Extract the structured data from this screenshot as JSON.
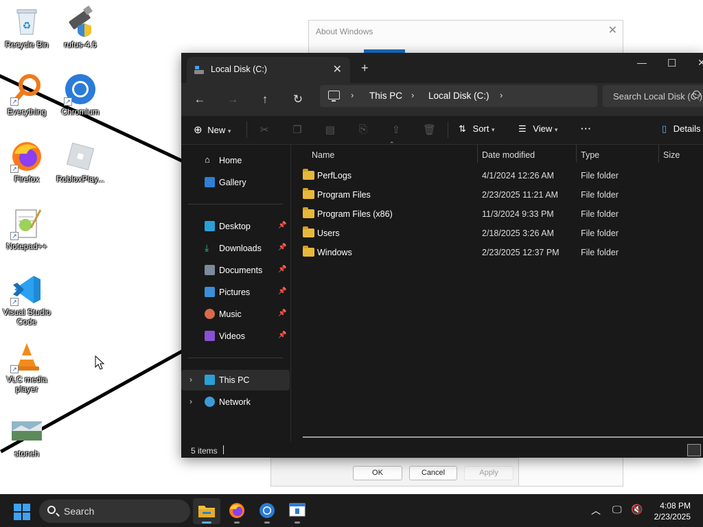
{
  "desktop": {
    "icons": [
      {
        "label": "Recycle Bin"
      },
      {
        "label": "rufus-4.6"
      },
      {
        "label": "Everything"
      },
      {
        "label": "Chromium"
      },
      {
        "label": "Firefox"
      },
      {
        "label": "RobloxPlay..."
      },
      {
        "label": "Notepad++"
      },
      {
        "label": "Visual Studio Code"
      },
      {
        "label": "VLC media player"
      },
      {
        "label": "stoneh"
      }
    ]
  },
  "about_dialog": {
    "title": "About Windows",
    "ok_label": "OK",
    "cancel_label": "Cancel",
    "apply_label": "Apply"
  },
  "explorer": {
    "tab_title": "Local Disk (C:)",
    "breadcrumb": [
      "This PC",
      "Local Disk (C:)"
    ],
    "search_placeholder": "Search Local Disk (C:)",
    "toolbar": {
      "new_label": "New",
      "sort_label": "Sort",
      "view_label": "View",
      "details_label": "Details"
    },
    "sidebar": {
      "home": "Home",
      "gallery": "Gallery",
      "quick": [
        {
          "label": "Desktop"
        },
        {
          "label": "Downloads"
        },
        {
          "label": "Documents"
        },
        {
          "label": "Pictures"
        },
        {
          "label": "Music"
        },
        {
          "label": "Videos"
        }
      ],
      "this_pc": "This PC",
      "network": "Network"
    },
    "columns": [
      "Name",
      "Date modified",
      "Type",
      "Size"
    ],
    "files": [
      {
        "name": "PerfLogs",
        "date": "4/1/2024 12:26 AM",
        "type": "File folder"
      },
      {
        "name": "Program Files",
        "date": "2/23/2025 11:21 AM",
        "type": "File folder"
      },
      {
        "name": "Program Files (x86)",
        "date": "11/3/2024 9:33 PM",
        "type": "File folder"
      },
      {
        "name": "Users",
        "date": "2/18/2025 3:26 AM",
        "type": "File folder"
      },
      {
        "name": "Windows",
        "date": "2/23/2025 12:37 PM",
        "type": "File folder"
      }
    ],
    "status": "5 items"
  },
  "taskbar": {
    "search_label": "Search",
    "time": "4:08 PM",
    "date": "2/23/2025"
  },
  "colors": {
    "accent": "#3ea2f4",
    "folder": "#e8b83a",
    "window_bg": "#191919"
  }
}
